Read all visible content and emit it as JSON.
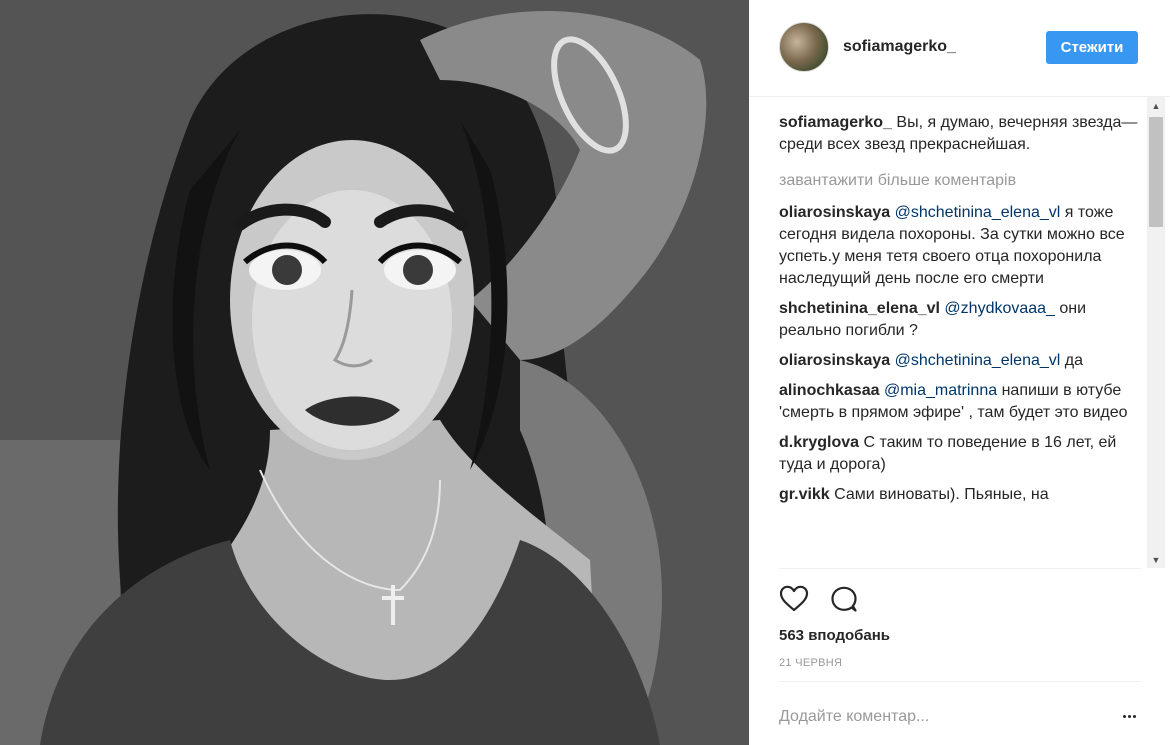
{
  "post": {
    "image_alt": "photo",
    "author": "sofiamagerko_",
    "follow_label": "Стежити"
  },
  "caption": {
    "user": "sofiamagerko_",
    "text": "Вы, я думаю, вечерняя звезда—\nсреди всех звезд прекраснейшая."
  },
  "load_more_label": "завантажити більше коментарів",
  "comments": [
    {
      "user": "oliarosinskaya",
      "mention": "@shchetinina_elena_vl",
      "text": "я тоже сегодня видела похороны. За сутки можно все успеть.у меня тетя своего отца похоронила наследущий день после его смерти"
    },
    {
      "user": "shchetinina_elena_vl",
      "mention": "@zhydkovaaa_",
      "text": "они реально погибли ?"
    },
    {
      "user": "oliarosinskaya",
      "mention": "@shchetinina_elena_vl",
      "text": "да"
    },
    {
      "user": "alinochkasaa",
      "mention": "@mia_matrinna",
      "text": "напиши в ютубе 'смерть в прямом эфире' , там будет это видео"
    },
    {
      "user": "d.kryglova",
      "mention": "",
      "text": "С таким то поведение в 16 лет, ей туда и дорога)"
    },
    {
      "user": "gr.vikk",
      "mention": "",
      "text": "Сами виноваты). Пьяные, на"
    }
  ],
  "likes_label": "563 вподобань",
  "date_label": "21 ЧЕРВНЯ",
  "add_comment": {
    "placeholder": "Додайте коментар..."
  },
  "icons": {
    "like": "heart-icon",
    "comment": "speech-bubble-icon",
    "more": "more-options-icon",
    "scroll_up": "triangle-up-icon",
    "scroll_down": "triangle-down-icon"
  },
  "colors": {
    "accent": "#3897f0",
    "mention": "#003569",
    "muted": "#999999",
    "text": "#262626"
  }
}
